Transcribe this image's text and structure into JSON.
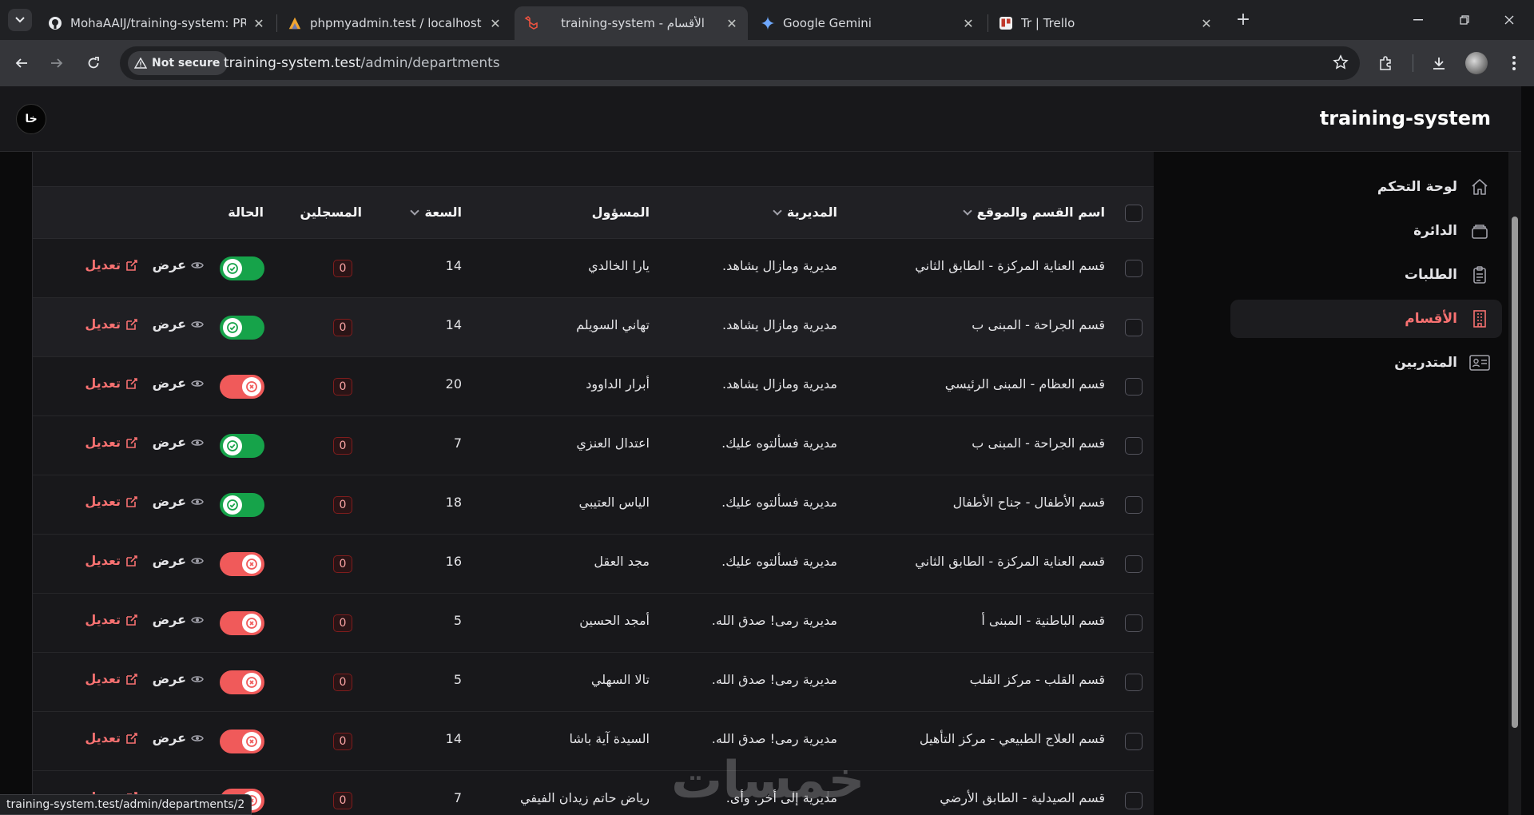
{
  "browser": {
    "tabs": [
      {
        "title": "MohaAAIJ/training-system: PRO",
        "icon": "github-icon",
        "active": false
      },
      {
        "title": "phpmyadmin.test / localhost / t",
        "icon": "phpmyadmin-icon",
        "active": false
      },
      {
        "title": "training-system - الأقسام",
        "icon": "laravel-icon",
        "active": true
      },
      {
        "title": "Google Gemini",
        "icon": "gemini-icon",
        "active": false
      },
      {
        "title": "Tr | Trello",
        "icon": "trello-icon",
        "active": false
      }
    ],
    "security_label": "Not secure",
    "url_host": "training-system.test",
    "url_path": "/admin/departments",
    "status_url": "training-system.test/admin/departments/2"
  },
  "app": {
    "brand": "training-system",
    "user_initials": "خا",
    "nav": [
      {
        "label": "لوحة التحكم",
        "icon": "home-icon",
        "active": false
      },
      {
        "label": "الدائرة",
        "icon": "layers-icon",
        "active": false
      },
      {
        "label": "الطلبات",
        "icon": "clipboard-icon",
        "active": false
      },
      {
        "label": "الأقسام",
        "icon": "building-icon",
        "active": true
      },
      {
        "label": "المتدربين",
        "icon": "id-card-icon",
        "active": false
      }
    ]
  },
  "table": {
    "columns": {
      "name": "اسم القسم والموقع",
      "directorate": "المديرية",
      "supervisor": "المسؤول",
      "capacity": "السعة",
      "registered": "المسجلين",
      "status": "الحالة"
    },
    "view_label": "عرض",
    "edit_label": "تعديل",
    "rows": [
      {
        "name": "قسم العناية المركزة - الطابق الثاني",
        "directorate": "مديرية ومازال يشاهد.",
        "supervisor": "يارا الخالدي",
        "capacity": "14",
        "registered": "0",
        "active": true
      },
      {
        "name": "قسم الجراحة - المبنى ب",
        "directorate": "مديرية ومازال يشاهد.",
        "supervisor": "تهاني السويلم",
        "capacity": "14",
        "registered": "0",
        "active": true
      },
      {
        "name": "قسم العظام - المبنى الرئيسي",
        "directorate": "مديرية ومازال يشاهد.",
        "supervisor": "أبرار الداوود",
        "capacity": "20",
        "registered": "0",
        "active": false
      },
      {
        "name": "قسم الجراحة - المبنى ب",
        "directorate": "مديرية فسألتوه عليك.",
        "supervisor": "اعتدال العنزي",
        "capacity": "7",
        "registered": "0",
        "active": true
      },
      {
        "name": "قسم الأطفال - جناح الأطفال",
        "directorate": "مديرية فسألتوه عليك.",
        "supervisor": "الياس العتيبي",
        "capacity": "18",
        "registered": "0",
        "active": true
      },
      {
        "name": "قسم العناية المركزة - الطابق الثاني",
        "directorate": "مديرية فسألتوه عليك.",
        "supervisor": "مجد العقل",
        "capacity": "16",
        "registered": "0",
        "active": false
      },
      {
        "name": "قسم الباطنية - المبنى أ",
        "directorate": "مديرية رمى! صدق الله.",
        "supervisor": "أمجد الحسين",
        "capacity": "5",
        "registered": "0",
        "active": false
      },
      {
        "name": "قسم القلب - مركز القلب",
        "directorate": "مديرية رمى! صدق الله.",
        "supervisor": "تالا السهلي",
        "capacity": "5",
        "registered": "0",
        "active": false
      },
      {
        "name": "قسم العلاج الطبيعي - مركز التأهيل",
        "directorate": "مديرية رمى! صدق الله.",
        "supervisor": "السيدة آية باشا",
        "capacity": "14",
        "registered": "0",
        "active": false
      },
      {
        "name": "قسم الصيدلية - الطابق الأرضي",
        "directorate": "مديرية إلى أخر. وأى.",
        "supervisor": "رياض حاتم زيدان الفيفي",
        "capacity": "7",
        "registered": "0",
        "active": false
      }
    ]
  },
  "watermark": "خمسات",
  "colors": {
    "accent_red": "#f87171",
    "toggle_on": "#16a34a",
    "toggle_off": "#f05a5a"
  }
}
